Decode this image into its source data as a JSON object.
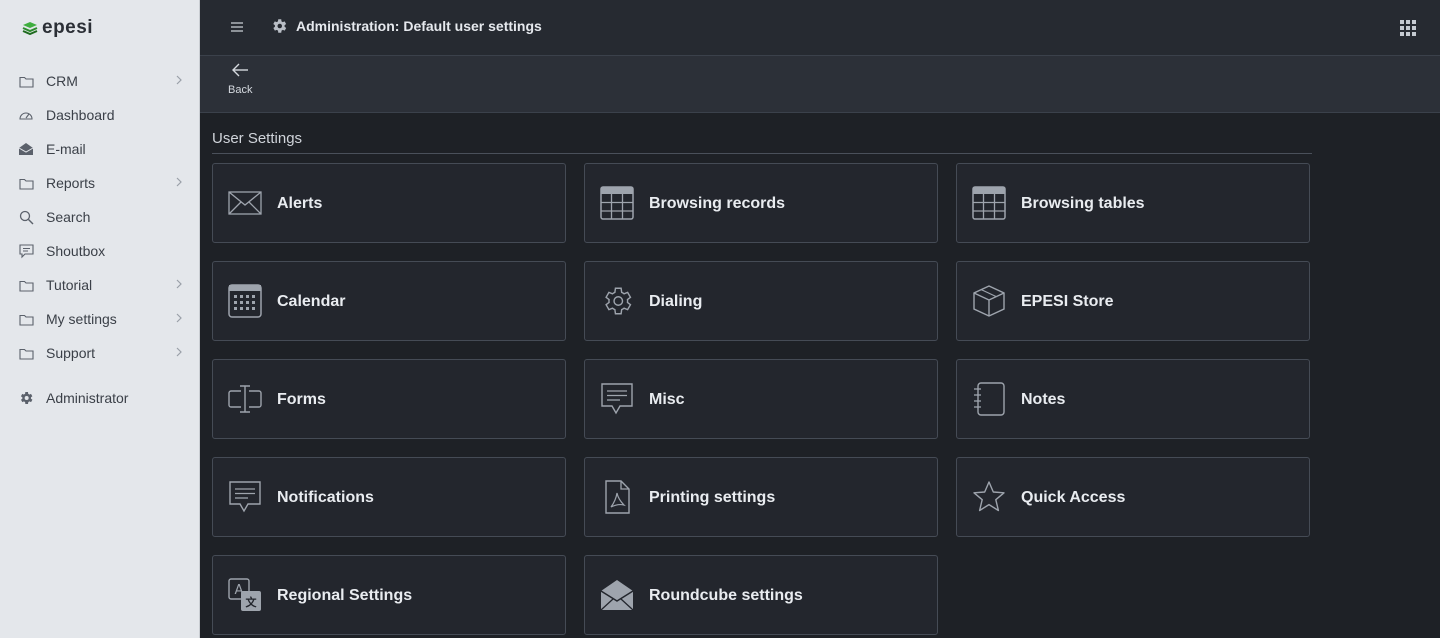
{
  "app": {
    "brand": "epesi"
  },
  "sidebar": {
    "items": [
      {
        "label": "CRM",
        "icon": "folder-icon",
        "has_children": true
      },
      {
        "label": "Dashboard",
        "icon": "dashboard-icon",
        "has_children": false
      },
      {
        "label": "E-mail",
        "icon": "mail-open-icon",
        "has_children": false
      },
      {
        "label": "Reports",
        "icon": "folder-icon",
        "has_children": true
      },
      {
        "label": "Search",
        "icon": "search-icon",
        "has_children": false
      },
      {
        "label": "Shoutbox",
        "icon": "chat-icon",
        "has_children": false
      },
      {
        "label": "Tutorial",
        "icon": "folder-icon",
        "has_children": true
      },
      {
        "label": "My settings",
        "icon": "folder-icon",
        "has_children": true
      },
      {
        "label": "Support",
        "icon": "folder-icon",
        "has_children": true
      }
    ],
    "admin": {
      "label": "Administrator",
      "icon": "gear-icon"
    }
  },
  "header": {
    "title": "Administration: Default user settings"
  },
  "actionbar": {
    "back_label": "Back"
  },
  "main": {
    "section_title": "User Settings",
    "tiles": [
      {
        "label": "Alerts",
        "icon": "envelope-icon"
      },
      {
        "label": "Browsing records",
        "icon": "table-grid-icon"
      },
      {
        "label": "Browsing tables",
        "icon": "table-grid-icon"
      },
      {
        "label": "Calendar",
        "icon": "calendar-icon"
      },
      {
        "label": "Dialing",
        "icon": "gear-icon"
      },
      {
        "label": "EPESI Store",
        "icon": "box-icon"
      },
      {
        "label": "Forms",
        "icon": "text-cursor-icon"
      },
      {
        "label": "Misc",
        "icon": "message-icon"
      },
      {
        "label": "Notes",
        "icon": "notebook-icon"
      },
      {
        "label": "Notifications",
        "icon": "message-icon"
      },
      {
        "label": "Printing settings",
        "icon": "pdf-file-icon"
      },
      {
        "label": "Quick Access",
        "icon": "star-icon"
      },
      {
        "label": "Regional Settings",
        "icon": "translate-icon"
      },
      {
        "label": "Roundcube settings",
        "icon": "mail-open-icon"
      }
    ]
  },
  "colors": {
    "sidebar_bg": "#e4e7eb",
    "topbar_bg": "#262a31",
    "content_bg": "#1e2126",
    "tile_bg": "#23262d",
    "tile_border": "#454b55",
    "brand_green": "#3fae3f"
  }
}
